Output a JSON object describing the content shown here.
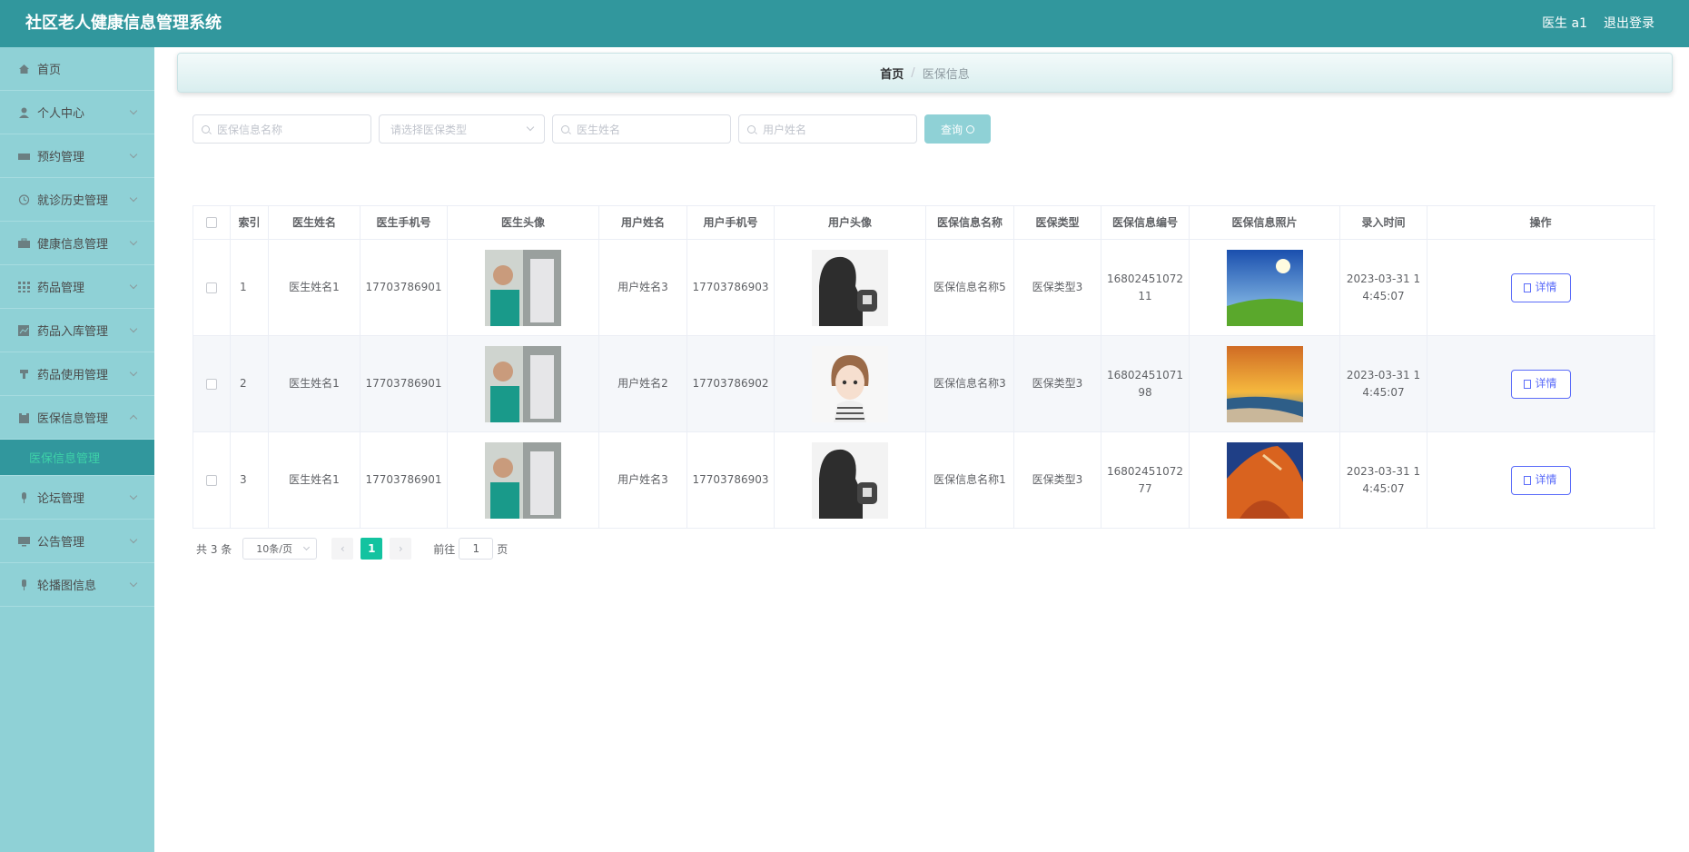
{
  "header": {
    "title": "社区老人健康信息管理系统",
    "user": "医生 a1",
    "logout": "退出登录"
  },
  "sidebar": {
    "items": [
      {
        "label": "首页",
        "icon": "home-icon"
      },
      {
        "label": "个人中心",
        "icon": "user-icon"
      },
      {
        "label": "预约管理",
        "icon": "ticket-icon"
      },
      {
        "label": "就诊历史管理",
        "icon": "clock-icon"
      },
      {
        "label": "健康信息管理",
        "icon": "briefcase-icon"
      },
      {
        "label": "药品管理",
        "icon": "grid-icon"
      },
      {
        "label": "药品入库管理",
        "icon": "chart-icon"
      },
      {
        "label": "药品使用管理",
        "icon": "cup-icon"
      },
      {
        "label": "医保信息管理",
        "icon": "clipboard-icon"
      },
      {
        "label": "论坛管理",
        "icon": "mic-icon"
      },
      {
        "label": "公告管理",
        "icon": "monitor-icon"
      },
      {
        "label": "轮播图信息",
        "icon": "pin-icon"
      }
    ],
    "active_sub": "医保信息管理"
  },
  "breadcrumb": {
    "home": "首页",
    "sep": "/",
    "current": "医保信息"
  },
  "search": {
    "name_placeholder": "医保信息名称",
    "type_placeholder": "请选择医保类型",
    "doctor_placeholder": "医生姓名",
    "user_placeholder": "用户姓名",
    "query_label": "查询"
  },
  "table": {
    "headers": [
      "索引",
      "医生姓名",
      "医生手机号",
      "医生头像",
      "用户姓名",
      "用户手机号",
      "用户头像",
      "医保信息名称",
      "医保类型",
      "医保信息编号",
      "医保信息照片",
      "录入时间",
      "操作"
    ],
    "rows": [
      {
        "index": "1",
        "doctor": "医生姓名1",
        "doctor_phone": "17703786901",
        "user": "用户姓名3",
        "user_phone": "17703786903",
        "name": "医保信息名称5",
        "type": "医保类型3",
        "code": "16802451072 11",
        "time": "2023-03-31 1 4:45:07",
        "action": "详情"
      },
      {
        "index": "2",
        "doctor": "医生姓名1",
        "doctor_phone": "17703786901",
        "user": "用户姓名2",
        "user_phone": "17703786902",
        "name": "医保信息名称3",
        "type": "医保类型3",
        "code": "16802451071 98",
        "time": "2023-03-31 1 4:45:07",
        "action": "详情"
      },
      {
        "index": "3",
        "doctor": "医生姓名1",
        "doctor_phone": "17703786901",
        "user": "用户姓名3",
        "user_phone": "17703786903",
        "name": "医保信息名称1",
        "type": "医保类型3",
        "code": "16802451072 77",
        "time": "2023-03-31 1 4:45:07",
        "action": "详情"
      }
    ]
  },
  "pagination": {
    "total": "共 3 条",
    "page_size": "10条/页",
    "current": "1",
    "goto_prefix": "前往",
    "goto_value": "1",
    "goto_suffix": "页"
  },
  "colors": {
    "header": "#31979d",
    "sidebar": "#8fd1d6",
    "accent": "#13c3a0",
    "button": "#5b6cf9"
  }
}
